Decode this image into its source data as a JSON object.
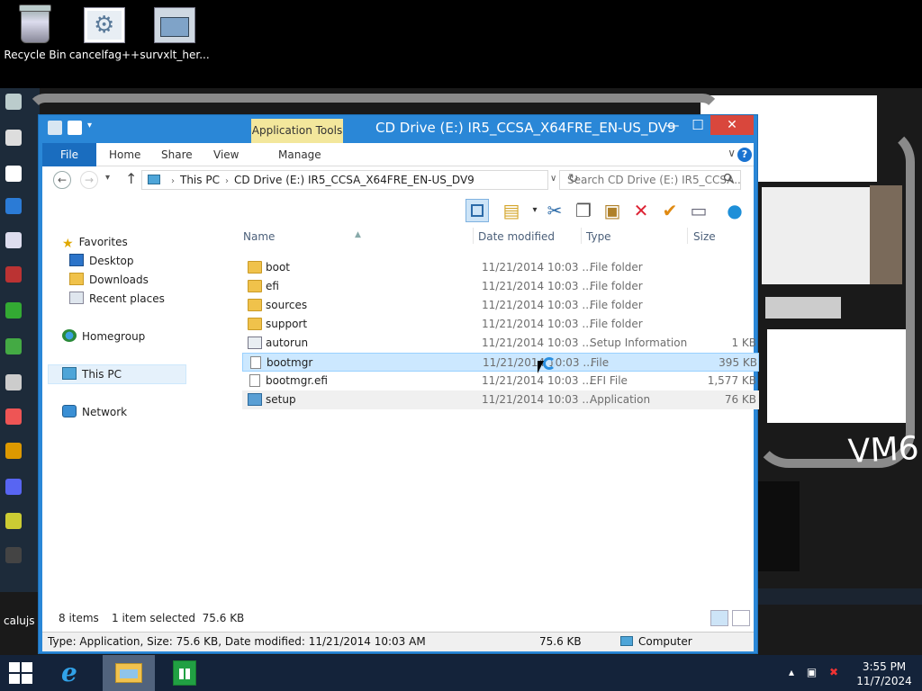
{
  "desktop": {
    "icons": [
      {
        "label": "Recycle Bin"
      },
      {
        "label": "cancelfag++"
      },
      {
        "label": "survxlt_her..."
      }
    ],
    "partial_label": "calujs",
    "handwritten": "VM6"
  },
  "window": {
    "title": "CD Drive (E:) IR5_CCSA_X64FRE_EN-US_DV9",
    "context_tab": "Application Tools",
    "controls": {
      "minimize": "—",
      "maximize": "☐",
      "close": "✕"
    }
  },
  "ribbon": {
    "tabs": [
      "File",
      "Home",
      "Share",
      "View",
      "Manage"
    ]
  },
  "address": {
    "crumbs": [
      "This PC",
      "CD Drive (E:) IR5_CCSA_X64FRE_EN-US_DV9"
    ],
    "search_placeholder": "Search CD Drive (E:) IR5_CCSA..."
  },
  "nav_pane": {
    "favorites": "Favorites",
    "favorites_items": [
      "Desktop",
      "Downloads",
      "Recent places"
    ],
    "homegroup": "Homegroup",
    "this_pc": "This PC",
    "network": "Network"
  },
  "columns": {
    "name": "Name",
    "date": "Date modified",
    "type": "Type",
    "size": "Size"
  },
  "files": [
    {
      "name": "boot",
      "date": "11/21/2014 10:03 ...",
      "type": "File folder",
      "size": "",
      "icon": "folder"
    },
    {
      "name": "efi",
      "date": "11/21/2014 10:03 ...",
      "type": "File folder",
      "size": "",
      "icon": "folder"
    },
    {
      "name": "sources",
      "date": "11/21/2014 10:03 ...",
      "type": "File folder",
      "size": "",
      "icon": "folder"
    },
    {
      "name": "support",
      "date": "11/21/2014 10:03 ...",
      "type": "File folder",
      "size": "",
      "icon": "folder"
    },
    {
      "name": "autorun",
      "date": "11/21/2014 10:03 ...",
      "type": "Setup Information",
      "size": "1 KB",
      "icon": "inf"
    },
    {
      "name": "bootmgr",
      "date": "11/21/2014 10:03 ...",
      "type": "File",
      "size": "395 KB",
      "icon": "file"
    },
    {
      "name": "bootmgr.efi",
      "date": "11/21/2014 10:03 ...",
      "type": "EFI File",
      "size": "1,577 KB",
      "icon": "file"
    },
    {
      "name": "setup",
      "date": "11/21/2014 10:03 ...",
      "type": "Application",
      "size": "76 KB",
      "icon": "app"
    }
  ],
  "status": {
    "count": "8 items",
    "selection": "1 item selected  75.6 KB"
  },
  "details": {
    "info": "Type: Application, Size: 75.6 KB, Date modified: 11/21/2014 10:03 AM",
    "size": "75.6 KB",
    "location": "Computer"
  },
  "taskbar": {
    "time": "3:55 PM",
    "date": "11/7/2024"
  }
}
